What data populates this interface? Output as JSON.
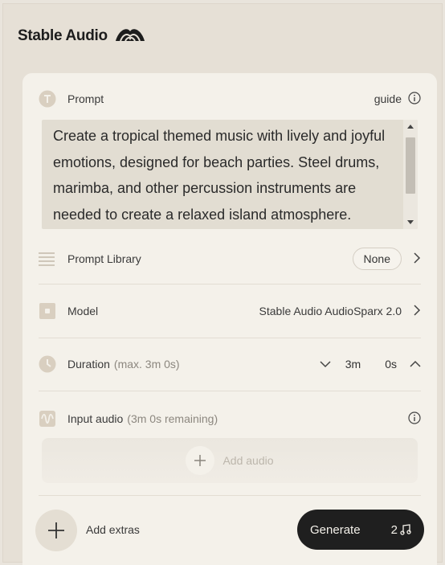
{
  "brand": {
    "name": "Stable Audio"
  },
  "prompt": {
    "label": "Prompt",
    "guide_label": "guide",
    "text": "Create a tropical themed music with lively and joyful emotions, designed for beach parties. Steel drums, marimba, and other percussion instruments are needed to create a relaxed island atmosphere. Perfect..."
  },
  "prompt_library": {
    "label": "Prompt Library",
    "value": "None"
  },
  "model": {
    "label": "Model",
    "value": "Stable Audio AudioSparx 2.0"
  },
  "duration": {
    "label": "Duration",
    "hint": "(max. 3m 0s)",
    "minutes": "3m",
    "seconds": "0s"
  },
  "input_audio": {
    "label": "Input audio",
    "hint": "(3m 0s remaining)",
    "add_label": "Add audio"
  },
  "footer": {
    "extras_label": "Add extras",
    "generate_label": "Generate",
    "generate_count": "2"
  },
  "colors": {
    "background": "#e9e4dc",
    "card": "#f4f1ea",
    "primary_button": "#1f1f1f",
    "muted_text": "#8c877f"
  },
  "icons": [
    "brand-logo-icon",
    "prompt-t-icon",
    "info-icon",
    "library-lines-icon",
    "chevron-right-icon",
    "model-square-icon",
    "clock-icon",
    "chevron-down-icon",
    "chevron-up-icon",
    "waveform-icon",
    "plus-icon",
    "music-note-icon"
  ]
}
